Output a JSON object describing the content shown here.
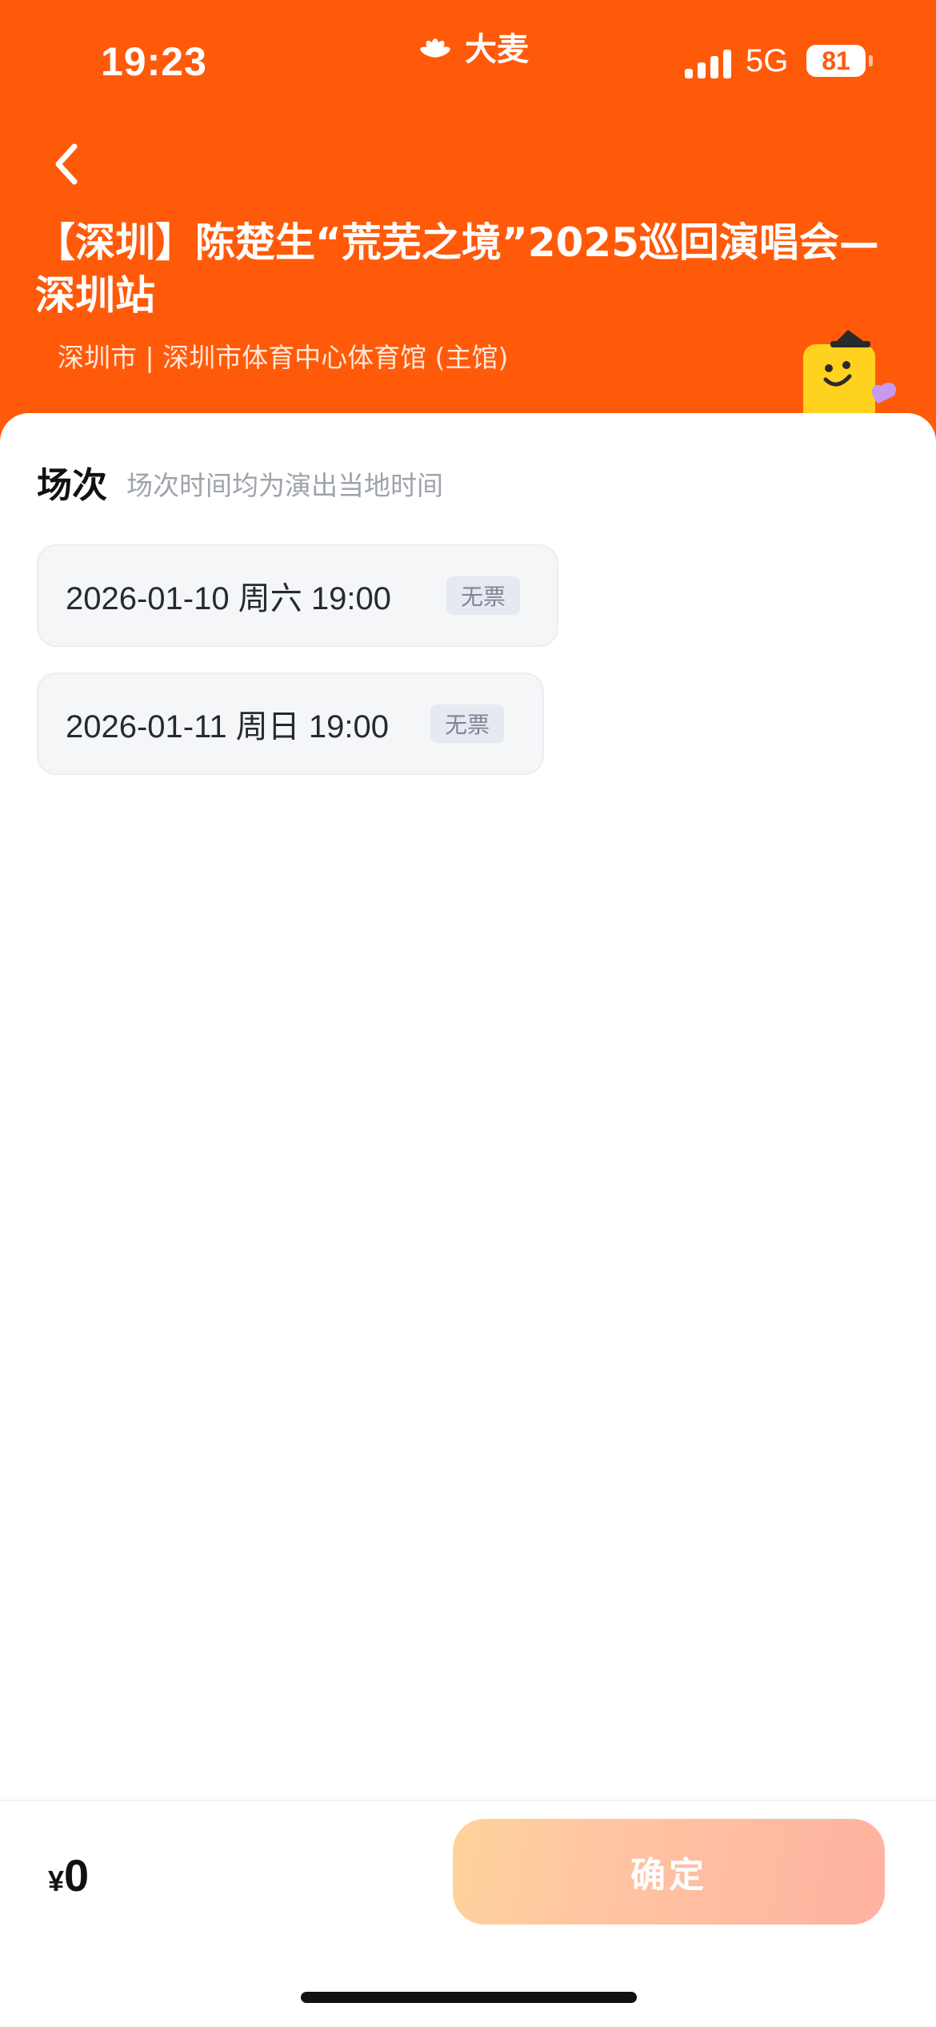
{
  "status_bar": {
    "time": "19:23",
    "network": "5G",
    "battery": "81"
  },
  "brand": {
    "name": "大麦"
  },
  "event": {
    "title": "【深圳】陈楚生“荒芜之境”2025巡回演唱会—深圳站",
    "venue": "深圳市 | 深圳市体育中心体育馆 (主馆)"
  },
  "sessions_section": {
    "title": "场次",
    "note": "场次时间均为演出当地时间",
    "items": [
      {
        "label": "2026-01-10  周六 19:00",
        "badge": "无票"
      },
      {
        "label": "2026-01-11 周日 19:00",
        "badge": "无票"
      }
    ]
  },
  "footer": {
    "currency": "¥",
    "price": "0",
    "confirm_label": "确定"
  },
  "colors": {
    "accent": "#ff5a0a",
    "sheet": "#ffffff"
  }
}
